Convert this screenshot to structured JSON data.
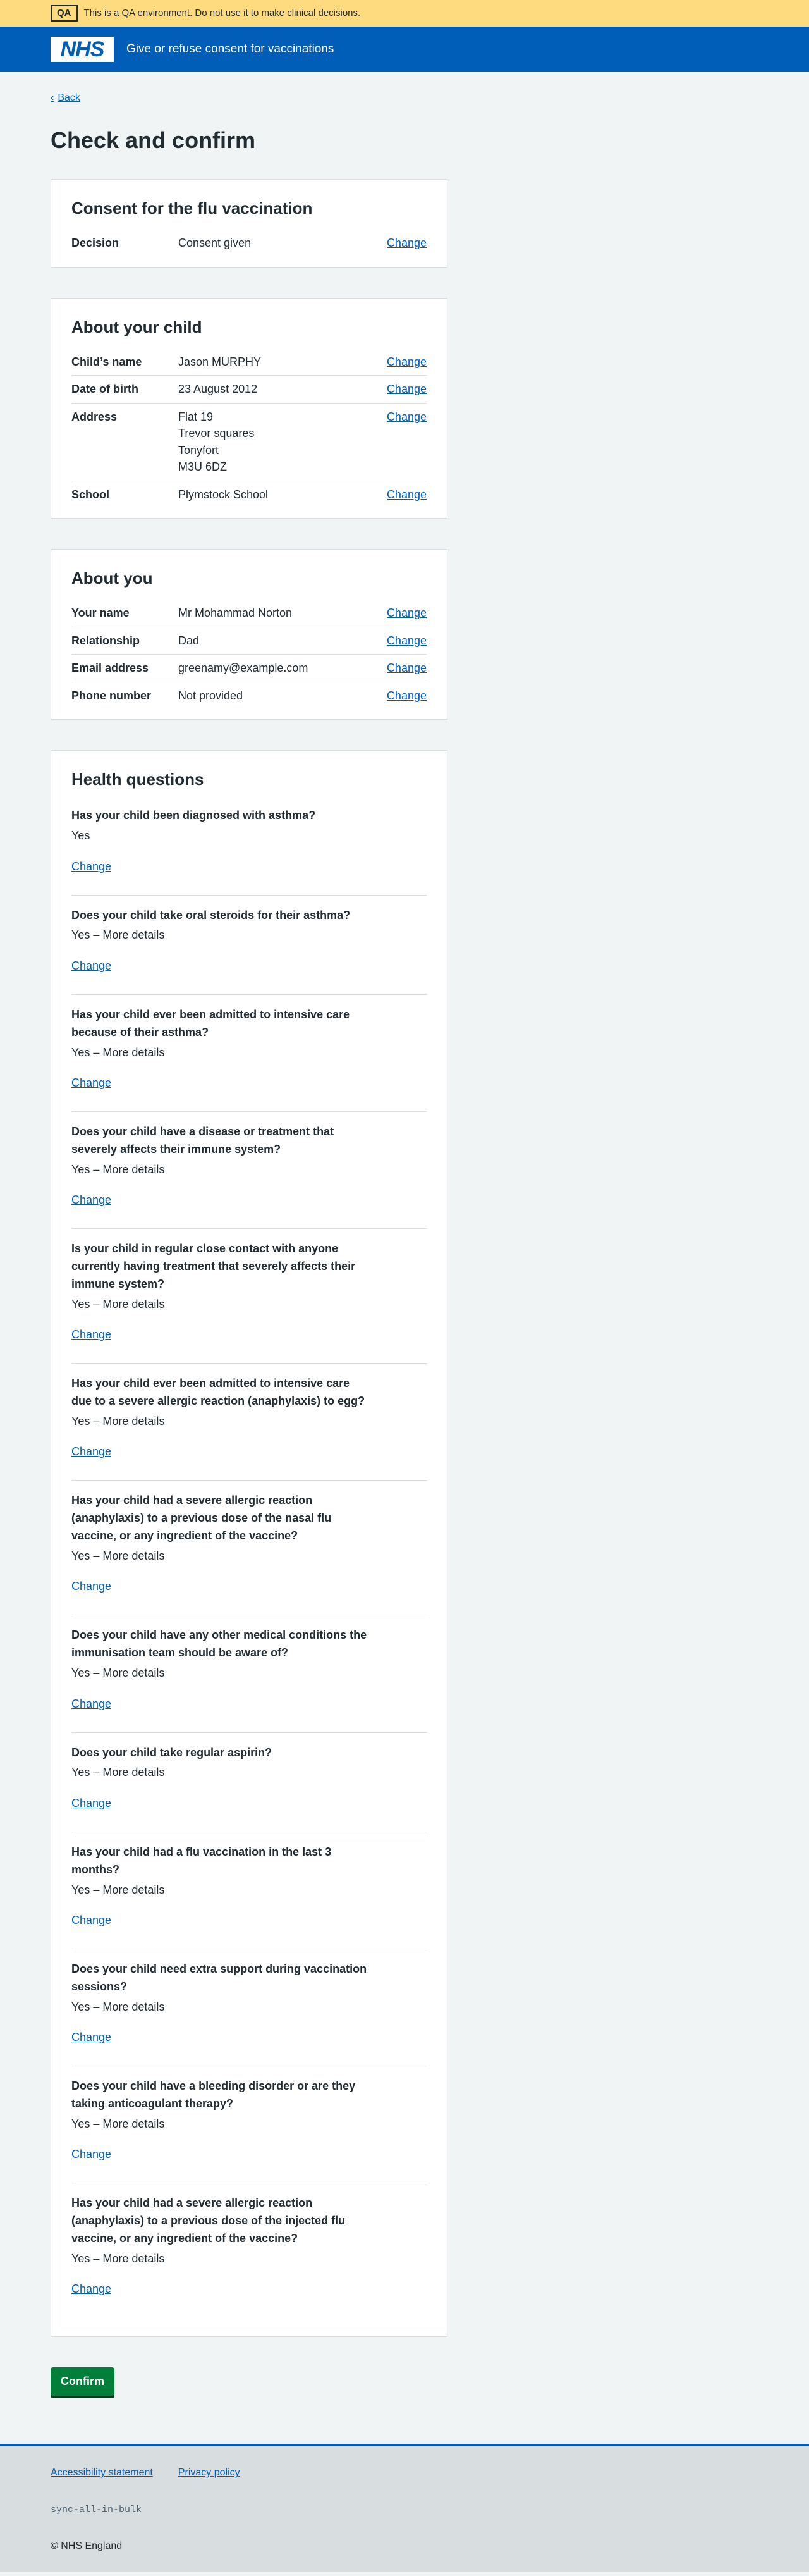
{
  "env_banner": {
    "tag": "QA",
    "text": "This is a QA environment. Do not use it to make clinical decisions."
  },
  "header": {
    "logo": "NHS",
    "service_name": "Give or refuse consent for vaccinations"
  },
  "back_link": "Back",
  "page_title": "Check and confirm",
  "change_label": "Change",
  "consent": {
    "heading": "Consent for the flu vaccination",
    "rows": [
      {
        "key": "Decision",
        "value": "Consent given"
      }
    ]
  },
  "child": {
    "heading": "About your child",
    "name_key": "Child’s name",
    "name": "Jason MURPHY",
    "dob_key": "Date of birth",
    "dob": "23 August 2012",
    "address_key": "Address",
    "address": [
      "Flat 19",
      "Trevor squares",
      "Tonyfort",
      "M3U 6DZ"
    ],
    "school_key": "School",
    "school": "Plymstock School"
  },
  "you": {
    "heading": "About you",
    "name_key": "Your name",
    "name": "Mr Mohammad Norton",
    "relationship_key": "Relationship",
    "relationship": "Dad",
    "email_key": "Email address",
    "email": "greenamy@example.com",
    "phone_key": "Phone number",
    "phone": "Not provided"
  },
  "health": {
    "heading": "Health questions",
    "questions": [
      {
        "q": "Has your child been diagnosed with asthma?",
        "a": "Yes"
      },
      {
        "q": "Does your child take oral steroids for their asthma?",
        "a": "Yes – More details"
      },
      {
        "q": "Has your child ever been admitted to intensive care because of their asthma?",
        "a": "Yes – More details"
      },
      {
        "q": "Does your child have a disease or treatment that severely affects their immune system?",
        "a": "Yes – More details"
      },
      {
        "q": "Is your child in regular close contact with anyone currently having treatment that severely affects their immune system?",
        "a": "Yes – More details"
      },
      {
        "q": "Has your child ever been admitted to intensive care due to a severe allergic reaction (anaphylaxis) to egg?",
        "a": "Yes – More details"
      },
      {
        "q": "Has your child had a severe allergic reaction (anaphylaxis) to a previous dose of the nasal flu vaccine, or any ingredient of the vaccine?",
        "a": "Yes – More details"
      },
      {
        "q": "Does your child have any other medical conditions the immunisation team should be aware of?",
        "a": "Yes – More details"
      },
      {
        "q": "Does your child take regular aspirin?",
        "a": "Yes – More details"
      },
      {
        "q": "Has your child had a flu vaccination in the last 3 months?",
        "a": "Yes – More details"
      },
      {
        "q": "Does your child need extra support during vaccination sessions?",
        "a": "Yes – More details"
      },
      {
        "q": "Does your child have a bleeding disorder or are they taking anticoagulant therapy?",
        "a": "Yes – More details"
      },
      {
        "q": "Has your child had a severe allergic reaction (anaphylaxis) to a previous dose of the injected flu vaccine, or any ingredient of the vaccine?",
        "a": "Yes – More details"
      }
    ]
  },
  "confirm_label": "Confirm",
  "footer": {
    "accessibility": "Accessibility statement",
    "privacy": "Privacy policy",
    "code": "sync-all-in-bulk",
    "copyright": "© NHS England"
  }
}
